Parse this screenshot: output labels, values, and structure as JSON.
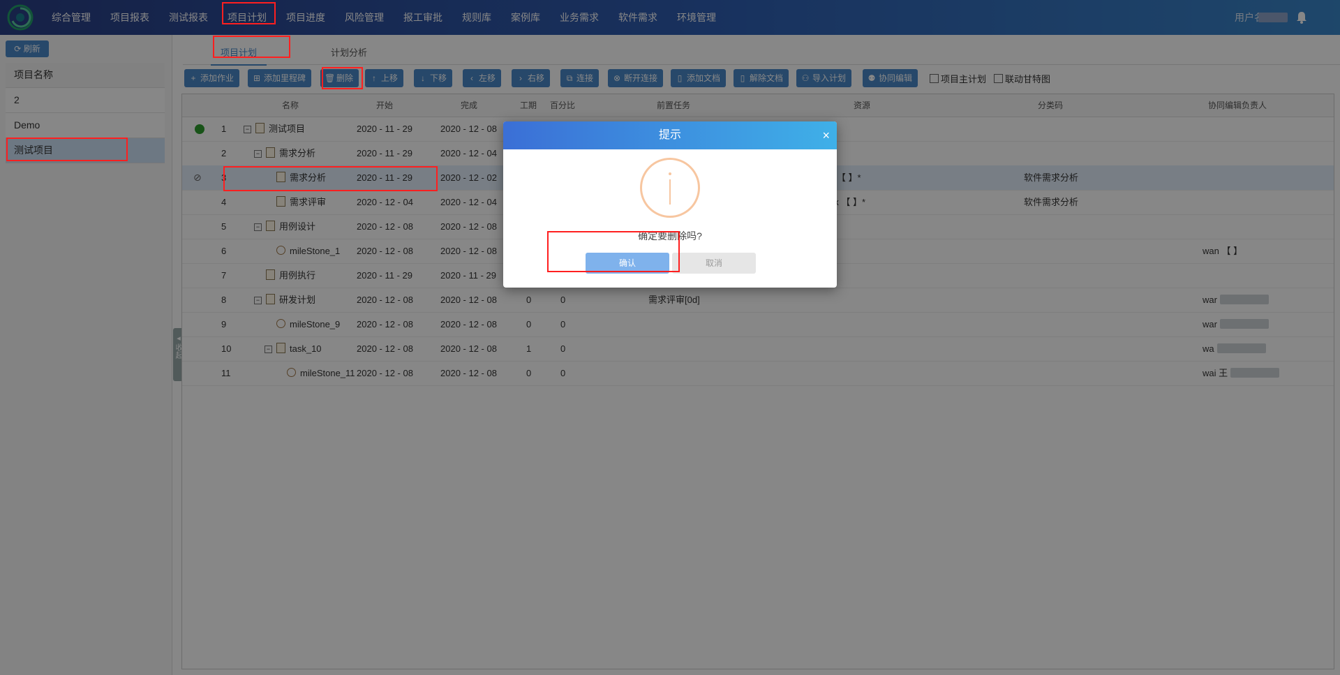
{
  "nav": {
    "items": [
      "综合管理",
      "项目报表",
      "测试报表",
      "项目计划",
      "项目进度",
      "风险管理",
      "报工审批",
      "规则库",
      "案例库",
      "业务需求",
      "软件需求",
      "环境管理"
    ],
    "active": "项目计划",
    "user_label": "用户名："
  },
  "sidebar": {
    "refresh_label": "刷新",
    "header": "项目名称",
    "projects": [
      "2",
      "Demo",
      "测试项目"
    ],
    "selected": "测试项目",
    "collapse_label": "收起"
  },
  "tabs": [
    "项目计划",
    "计划分析"
  ],
  "toolbar": {
    "buttons": [
      "添加作业",
      "添加里程碑",
      "删除",
      "上移",
      "下移",
      "左移",
      "右移",
      "连接",
      "断开连接",
      "添加文档",
      "解除文档",
      "导入计划",
      "协同编辑"
    ],
    "checkboxes": [
      "项目主计划",
      "联动甘特图"
    ]
  },
  "grid": {
    "columns": [
      "名称",
      "开始",
      "完成",
      "工期",
      "百分比",
      "前置任务",
      "资源",
      "分类码",
      "协同编辑负责人"
    ],
    "rows": [
      {
        "no": "1",
        "name": "测试项目",
        "start": "2020 - 11 - 29",
        "end": "2020 - 12 - 08",
        "dur": "",
        "pct": "",
        "pred": "",
        "res": "",
        "code": "",
        "owner": ""
      },
      {
        "no": "2",
        "name": "需求分析",
        "start": "2020 - 11 - 29",
        "end": "2020 - 12 - 04",
        "dur": "",
        "pct": "",
        "pred": "",
        "res": "",
        "code": "",
        "owner": ""
      },
      {
        "no": "3",
        "name": "需求分析",
        "start": "2020 - 11 - 29",
        "end": "2020 - 12 - 02",
        "dur": "",
        "pct": "",
        "pred": "",
        "res": "ri  【  】*",
        "code": "软件需求分析",
        "owner": ""
      },
      {
        "no": "4",
        "name": "需求评审",
        "start": "2020 - 12 - 04",
        "end": "2020 - 12 - 04",
        "dur": "",
        "pct": "",
        "pred": "",
        "res": "ex  【  】*",
        "code": "软件需求分析",
        "owner": ""
      },
      {
        "no": "5",
        "name": "用例设计",
        "start": "2020 - 12 - 08",
        "end": "2020 - 12 - 08",
        "dur": "",
        "pct": "",
        "pred": "",
        "res": "",
        "code": "",
        "owner": ""
      },
      {
        "no": "6",
        "name": "mileStone_1",
        "start": "2020 - 12 - 08",
        "end": "2020 - 12 - 08",
        "dur": "",
        "pct": "",
        "pred": "",
        "res": "",
        "code": "",
        "owner": "wan  【  】"
      },
      {
        "no": "7",
        "name": "用例执行",
        "start": "2020 - 11 - 29",
        "end": "2020 - 11 - 29",
        "dur": "",
        "pct": "",
        "pred": "",
        "res": "",
        "code": "",
        "owner": ""
      },
      {
        "no": "8",
        "name": "研发计划",
        "start": "2020 - 12 - 08",
        "end": "2020 - 12 - 08",
        "dur": "0",
        "pct": "0",
        "pred": "需求评审[0d]",
        "res": "",
        "code": "",
        "owner": "war"
      },
      {
        "no": "9",
        "name": "mileStone_9",
        "start": "2020 - 12 - 08",
        "end": "2020 - 12 - 08",
        "dur": "0",
        "pct": "0",
        "pred": "",
        "res": "",
        "code": "",
        "owner": "war"
      },
      {
        "no": "10",
        "name": "task_10",
        "start": "2020 - 12 - 08",
        "end": "2020 - 12 - 08",
        "dur": "1",
        "pct": "0",
        "pred": "",
        "res": "",
        "code": "",
        "owner": "wa"
      },
      {
        "no": "11",
        "name": "mileStone_11",
        "start": "2020 - 12 - 08",
        "end": "2020 - 12 - 08",
        "dur": "0",
        "pct": "0",
        "pred": "",
        "res": "",
        "code": "",
        "owner": "wai   王"
      }
    ]
  },
  "dialog": {
    "title": "提示",
    "message": "确定要删除吗?",
    "ok": "确认",
    "cancel": "取消",
    "close": "×"
  },
  "colors": {
    "accent": "#4a88c8",
    "highlight": "#ff1f1f"
  }
}
